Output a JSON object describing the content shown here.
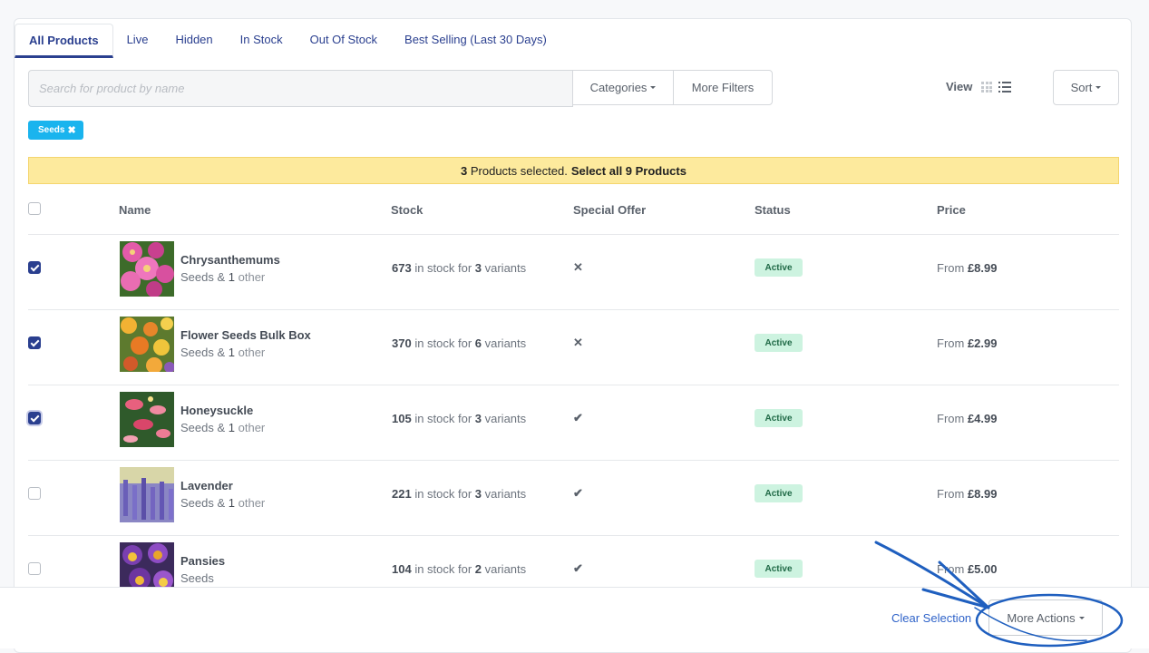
{
  "tabs": [
    {
      "label": "All Products",
      "active": true
    },
    {
      "label": "Live"
    },
    {
      "label": "Hidden"
    },
    {
      "label": "In Stock"
    },
    {
      "label": "Out Of Stock"
    },
    {
      "label": "Best Selling (Last 30 Days)"
    }
  ],
  "search": {
    "placeholder": "Search for product by name"
  },
  "filters": {
    "categories_label": "Categories",
    "more_filters_label": "More Filters"
  },
  "view": {
    "label": "View",
    "mode": "list"
  },
  "sort": {
    "label": "Sort"
  },
  "active_filter_chip": {
    "label": "Seeds",
    "remove_icon": "close-icon"
  },
  "selection_banner": {
    "selected_count": "3",
    "selected_text": "Products selected.",
    "select_all_text": "Select all 9 Products"
  },
  "columns": {
    "name": "Name",
    "stock": "Stock",
    "special_offer": "Special Offer",
    "status": "Status",
    "price": "Price"
  },
  "products": [
    {
      "name": "Chrysanthemums",
      "category": "Seeds",
      "amp": " & ",
      "other_count": "1",
      "other_word": " other",
      "stock_qty": "673",
      "stock_mid": " in stock for ",
      "variants": "3",
      "variants_word": " variants",
      "offer": "✕",
      "offer_icon": "cross-icon",
      "status": "Active",
      "price_prefix": "From ",
      "price": "£8.99",
      "checked": true
    },
    {
      "name": "Flower Seeds Bulk Box",
      "category": "Seeds",
      "amp": " & ",
      "other_count": "1",
      "other_word": " other",
      "stock_qty": "370",
      "stock_mid": " in stock for ",
      "variants": "6",
      "variants_word": " variants",
      "offer": "✕",
      "offer_icon": "cross-icon",
      "status": "Active",
      "price_prefix": "From ",
      "price": "£2.99",
      "checked": true
    },
    {
      "name": "Honeysuckle",
      "category": "Seeds",
      "amp": " & ",
      "other_count": "1",
      "other_word": " other",
      "stock_qty": "105",
      "stock_mid": " in stock for ",
      "variants": "3",
      "variants_word": " variants",
      "offer": "✔",
      "offer_icon": "check-icon",
      "status": "Active",
      "price_prefix": "From ",
      "price": "£4.99",
      "checked": true
    },
    {
      "name": "Lavender",
      "category": "Seeds",
      "amp": " & ",
      "other_count": "1",
      "other_word": " other",
      "stock_qty": "221",
      "stock_mid": " in stock for ",
      "variants": "3",
      "variants_word": " variants",
      "offer": "✔",
      "offer_icon": "check-icon",
      "status": "Active",
      "price_prefix": "From ",
      "price": "£8.99",
      "checked": false
    },
    {
      "name": "Pansies",
      "category": "Seeds",
      "amp": "",
      "other_count": "",
      "other_word": "",
      "stock_qty": "104",
      "stock_mid": " in stock for ",
      "variants": "2",
      "variants_word": " variants",
      "offer": "✔",
      "offer_icon": "check-icon",
      "status": "Active",
      "price_prefix": "From ",
      "price": "£5.00",
      "checked": false
    }
  ],
  "footer": {
    "clear_selection": "Clear Selection",
    "more_actions": "More Actions"
  },
  "colors": {
    "accent": "#2a3f8f",
    "chip": "#1ab4ee",
    "banner": "#fdea9d",
    "badge_bg": "#cdf3e0",
    "annotation": "#1f5fbf"
  }
}
